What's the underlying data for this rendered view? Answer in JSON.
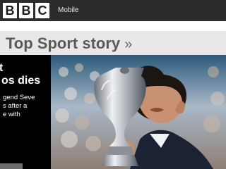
{
  "brand": {
    "logo_letters": [
      "B",
      "B",
      "C"
    ]
  },
  "header": {
    "site_section": "Mobile"
  },
  "page": {
    "title": "Top Sport story",
    "title_suffix": "»"
  },
  "story": {
    "headline_line1": "t",
    "headline_line2": "os dies",
    "summary_lines": [
      "gend Seve",
      "s after a",
      "e with",
      ""
    ]
  },
  "colors": {
    "topbar": "#2b2b2b",
    "header_bg": "#e8e8e8",
    "title_text": "#5a5a5a",
    "panel_bg": "#000000"
  },
  "images": {
    "main_photo": "golfer-kissing-trophy"
  }
}
